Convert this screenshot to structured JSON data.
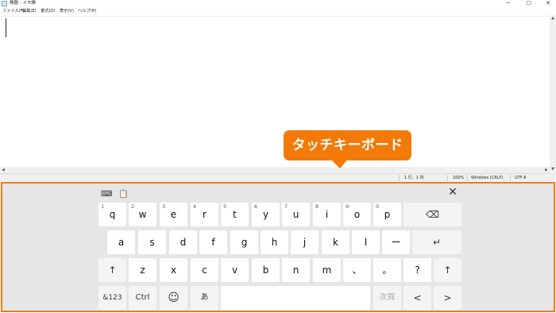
{
  "window": {
    "title": "無題 - メモ帳",
    "controls": {
      "minimize": "─",
      "maximize": "☐",
      "close": "✕"
    }
  },
  "menubar": [
    {
      "label": "ファイル(F)"
    },
    {
      "label": "編集(E)"
    },
    {
      "label": "書式(O)"
    },
    {
      "label": "表示(V)"
    },
    {
      "label": "ヘルプ(H)"
    }
  ],
  "editor": {
    "text": ""
  },
  "scrollbar": {
    "up": "▲",
    "down": "▼",
    "left": "◀",
    "right": "▶"
  },
  "statusbar": {
    "position": "1 行、1 列",
    "zoom": "100%",
    "line_ending": "Windows (CRLF)",
    "encoding": "UTF-8"
  },
  "callout": {
    "text": "タッチキーボード",
    "color": "#f37a08"
  },
  "keyboard": {
    "border_color": "#f37a08",
    "toolbar": {
      "keyboard_settings_icon": "⌨",
      "clipboard_icon": "📋",
      "close": "✕"
    },
    "row1": [
      {
        "label": "q",
        "num": "1"
      },
      {
        "label": "w",
        "num": "2"
      },
      {
        "label": "e",
        "num": "3"
      },
      {
        "label": "r",
        "num": "4"
      },
      {
        "label": "t",
        "num": "5"
      },
      {
        "label": "y",
        "num": "6"
      },
      {
        "label": "u",
        "num": "7"
      },
      {
        "label": "i",
        "num": "8"
      },
      {
        "label": "o",
        "num": "9"
      },
      {
        "label": "p",
        "num": "0"
      }
    ],
    "backspace": "⌫",
    "row2": [
      {
        "label": "a"
      },
      {
        "label": "s"
      },
      {
        "label": "d"
      },
      {
        "label": "f"
      },
      {
        "label": "g"
      },
      {
        "label": "h"
      },
      {
        "label": "j"
      },
      {
        "label": "k"
      },
      {
        "label": "l"
      },
      {
        "label": "ー"
      }
    ],
    "enter": "↵",
    "shift": "↑",
    "row3": [
      {
        "label": "z"
      },
      {
        "label": "x"
      },
      {
        "label": "c"
      },
      {
        "label": "v"
      },
      {
        "label": "b"
      },
      {
        "label": "n"
      },
      {
        "label": "m"
      },
      {
        "label": "、"
      },
      {
        "label": "。"
      },
      {
        "label": "?"
      }
    ],
    "row4": {
      "symbols": "&123",
      "ctrl": "Ctrl",
      "emoji": "☺",
      "ime": "あ",
      "space": "",
      "next_candidate": "次頁",
      "left": "<",
      "right": ">"
    }
  }
}
